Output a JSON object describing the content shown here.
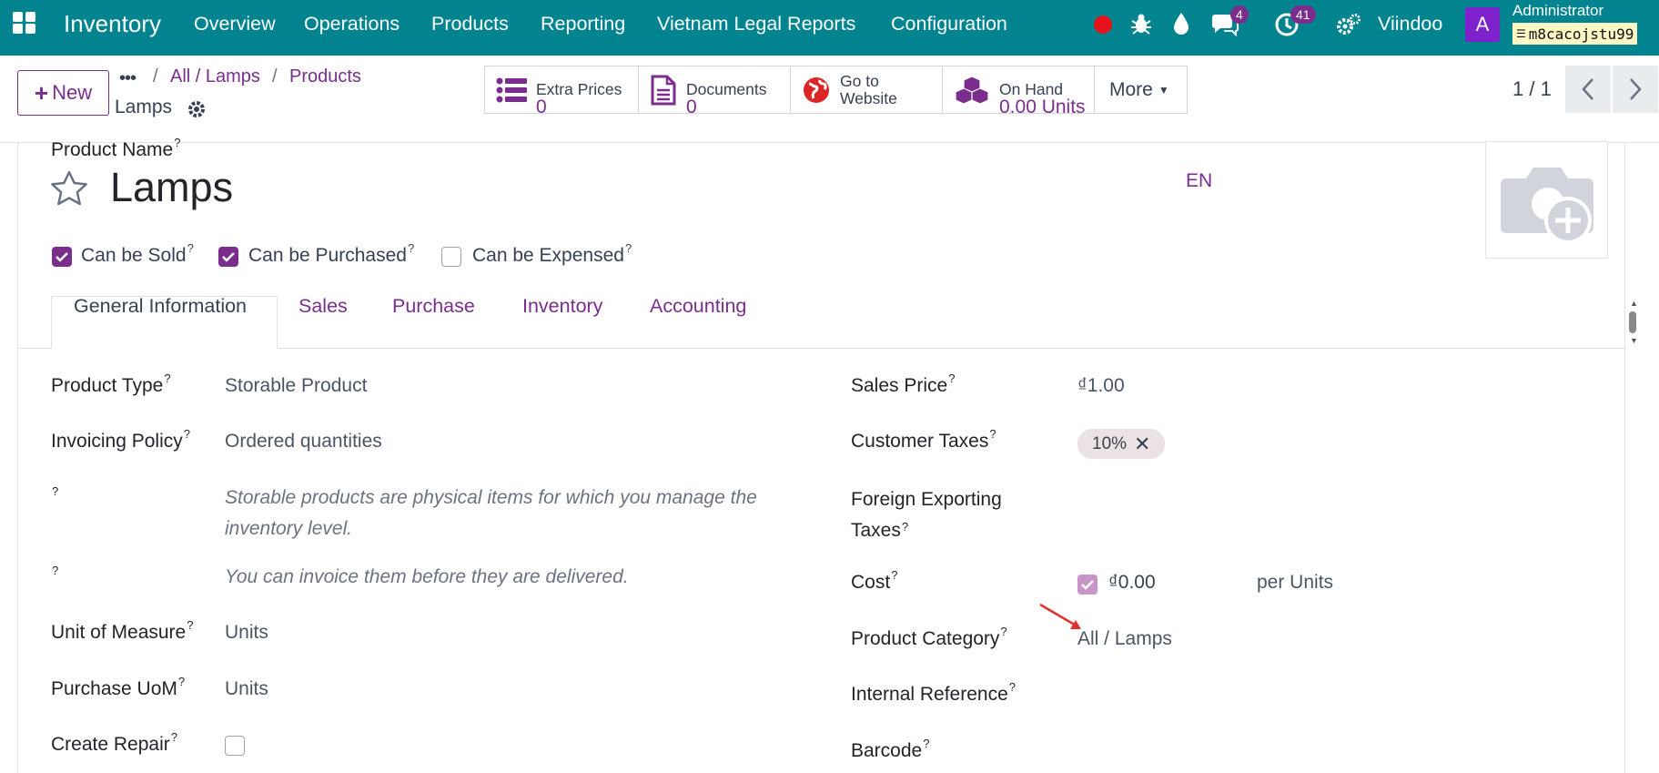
{
  "topbar": {
    "app": "Inventory",
    "menu": [
      "Overview",
      "Operations",
      "Products",
      "Reporting",
      "Vietnam Legal Reports",
      "Configuration"
    ],
    "chat_count": "4",
    "activity_count": "41",
    "company": "Viindoo",
    "avatar_letter": "A",
    "user": "Administrator",
    "database": "m8cacojstu99"
  },
  "control": {
    "new_label": "New",
    "breadcrumb": [
      "All / Lamps",
      "Products"
    ],
    "record_name": "Lamps",
    "smart_buttons": {
      "extra_prices": {
        "label": "Extra Prices",
        "value": "0"
      },
      "documents": {
        "label": "Documents",
        "value": "0"
      },
      "website": {
        "line1": "Go to",
        "line2": "Website"
      },
      "on_hand": {
        "label": "On Hand",
        "value": "0.00 Units"
      }
    },
    "more_label": "More",
    "pager": "1 / 1"
  },
  "form": {
    "product_name_label": "Product Name",
    "help_mark": "?",
    "product_name": "Lamps",
    "lang": "EN",
    "checkboxes": [
      {
        "label": "Can be Sold",
        "checked": true
      },
      {
        "label": "Can be Purchased",
        "checked": true
      },
      {
        "label": "Can be Expensed",
        "checked": false
      }
    ],
    "tabs": [
      "General Information",
      "Sales",
      "Purchase",
      "Inventory",
      "Accounting"
    ],
    "left": {
      "product_type_label": "Product Type",
      "product_type": "Storable Product",
      "invoicing_label": "Invoicing Policy",
      "invoicing": "Ordered quantities",
      "hint1": "Storable products are physical items for which you manage the inventory level.",
      "hint2": "You can invoice them before they are delivered.",
      "uom_label": "Unit of Measure",
      "uom": "Units",
      "purchase_uom_label": "Purchase UoM",
      "purchase_uom": "Units",
      "repair_label": "Create Repair"
    },
    "right": {
      "sales_price_label": "Sales Price",
      "sales_price": "₫1.00",
      "customer_taxes_label": "Customer Taxes",
      "customer_tax_tag": "10%",
      "foreign_taxes_label_1": "Foreign Exporting",
      "foreign_taxes_label_2": "Taxes",
      "cost_label": "Cost",
      "cost": "₫0.00",
      "cost_unit": "per Units",
      "category_label": "Product Category",
      "category": "All / Lamps",
      "internal_ref_label": "Internal Reference",
      "barcode_label": "Barcode"
    }
  },
  "colors": {
    "topbar": "#01848f",
    "accent": "#7b2d8e",
    "annotation": "#e03131"
  }
}
